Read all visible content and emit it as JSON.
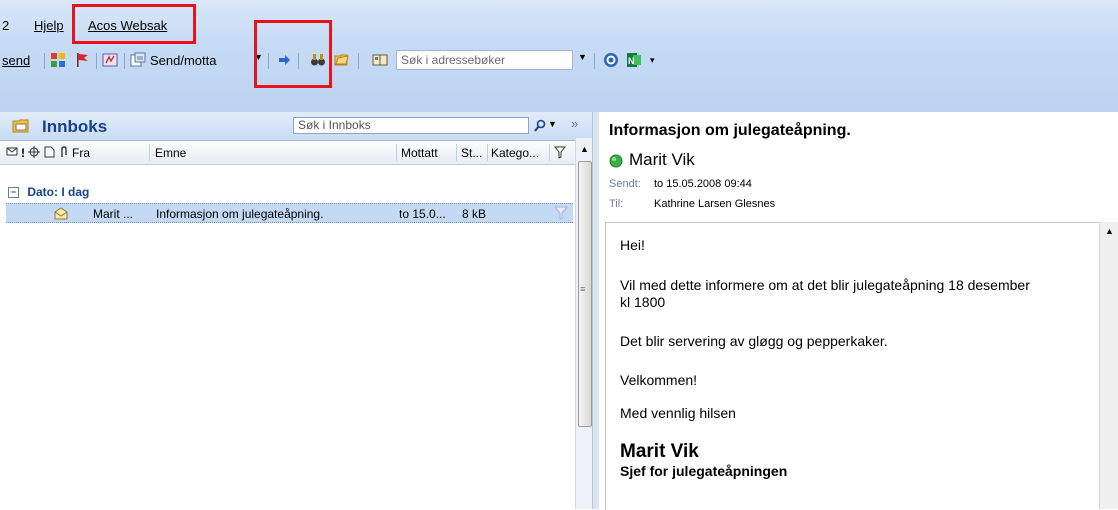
{
  "menubar": {
    "item_partial": "2",
    "help": "Hjelp",
    "acos": "Acos Websak"
  },
  "toolbar": {
    "send_partial": "send",
    "send_receive": "Send/motta",
    "search_placeholder": "Søk i adressebøker"
  },
  "inbox": {
    "title": "Innboks",
    "search_placeholder": "Søk i Innboks",
    "columns": [
      "Fra",
      "Emne",
      "Mottatt",
      "St...",
      "Katego..."
    ],
    "group_label": "Dato: I dag",
    "rows": [
      {
        "from": "Marit ...",
        "subject": "Informasjon om julegateåpning.",
        "received": "to 15.0...",
        "size": "8 kB"
      }
    ]
  },
  "message": {
    "subject": "Informasjon om julegateåpning.",
    "sender": "Marit Vik",
    "sent_label": "Sendt:",
    "sent_value": "to 15.05.2008 09:44",
    "to_label": "Til:",
    "to_value": "Kathrine Larsen Glesnes",
    "body": {
      "greeting": "Hei!",
      "line1a": "Vil med dette informere om at det blir julegateåpning 18 desember",
      "line1b": "kl 1800",
      "line2": "Det blir servering av gløgg og pepperkaker.",
      "line3": "Velkommen!",
      "line4": "Med vennlig hilsen",
      "sig_name": "Marit Vik",
      "sig_title": "Sjef for julegateåpningen"
    }
  },
  "colors": {
    "chrome": "#c6dbf5",
    "header_text": "#15428b",
    "annotation": "#e8141c",
    "selection": "#c4d9f3",
    "presence": "#3cb043"
  },
  "icons": [
    "color-categories-icon",
    "flag-icon",
    "rules-icon",
    "send-receive-icon",
    "forward-arrow-icon",
    "find-binoculars-icon",
    "folder-icon",
    "address-book-icon",
    "help-icon",
    "onenote-icon",
    "envelope-icon",
    "importance-icon",
    "reminder-icon",
    "attachment-icon",
    "flag-column-icon",
    "presence-icon"
  ]
}
